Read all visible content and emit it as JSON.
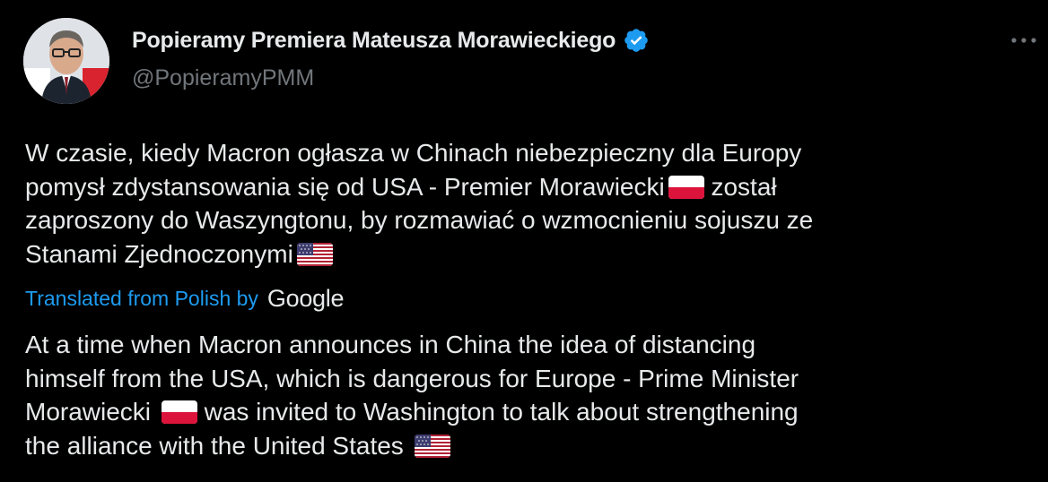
{
  "author": {
    "display_name": "Popieramy Premiera Mateusza Morawieckiego",
    "handle": "@PopieramyPMM",
    "verified_icon": "verified-badge-icon",
    "more_icon": "more-horizontal-icon"
  },
  "tweet": {
    "original_lines": [
      "W czasie, kiedy Macron ogłasza w Chinach niebezpieczny dla Europy",
      "pomysł zdystansowania się od USA - Premier Morawiecki",
      "został",
      "zaproszony do Waszyngtonu, by rozmawiać o wzmocnieniu sojuszu ze",
      "Stanami Zjednoczonymi"
    ],
    "translated_from": "Translated from Polish by",
    "translator": "Google",
    "translation_lines": [
      "At a time when Macron announces in China the idea of distancing",
      "himself from the USA, which is dangerous for Europe - Prime Minister",
      "Morawiecki",
      "was invited to Washington to talk about strengthening",
      "the alliance with the United States"
    ]
  },
  "colors": {
    "background": "#000000",
    "text": "#e7e9ea",
    "secondary": "#71767b",
    "link": "#1d9bf0",
    "verified": "#1d9bf0"
  }
}
